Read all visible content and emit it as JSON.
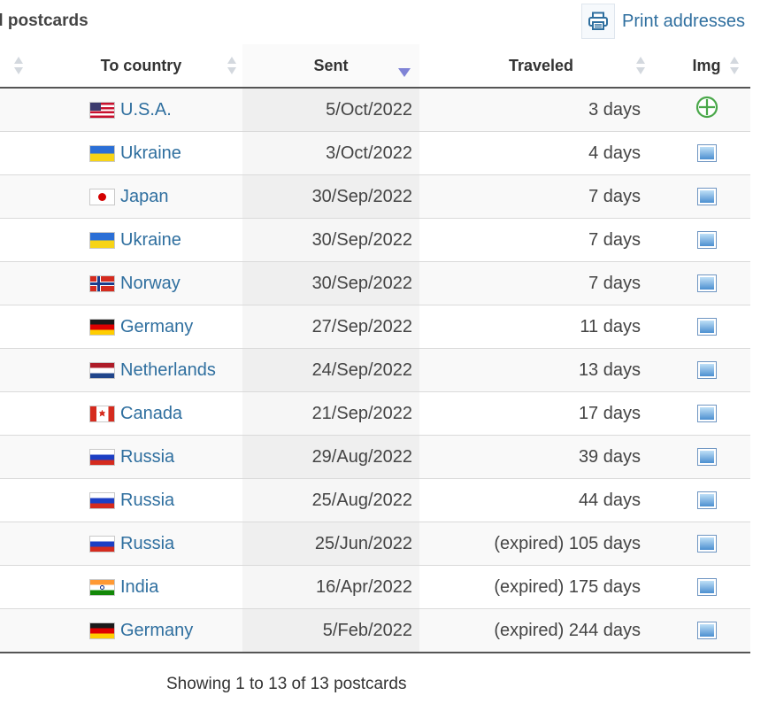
{
  "page": {
    "title": "d postcards"
  },
  "toolbar": {
    "print_label": "Print addresses"
  },
  "table": {
    "headers": {
      "to_country": "To country",
      "sent": "Sent",
      "traveled": "Traveled",
      "img": "Img"
    },
    "rows": [
      {
        "country": "U.S.A.",
        "flag": "us",
        "sent": "5/Oct/2022",
        "traveled": "3 days",
        "img": "add-icon"
      },
      {
        "country": "Ukraine",
        "flag": "ua",
        "sent": "3/Oct/2022",
        "traveled": "4 days",
        "img": "image-icon"
      },
      {
        "country": "Japan",
        "flag": "jp",
        "sent": "30/Sep/2022",
        "traveled": "7 days",
        "img": "image-icon"
      },
      {
        "country": "Ukraine",
        "flag": "ua",
        "sent": "30/Sep/2022",
        "traveled": "7 days",
        "img": "image-icon"
      },
      {
        "country": "Norway",
        "flag": "no",
        "sent": "30/Sep/2022",
        "traveled": "7 days",
        "img": "image-icon"
      },
      {
        "country": "Germany",
        "flag": "de",
        "sent": "27/Sep/2022",
        "traveled": "11 days",
        "img": "image-icon"
      },
      {
        "country": "Netherlands",
        "flag": "nl",
        "sent": "24/Sep/2022",
        "traveled": "13 days",
        "img": "image-icon"
      },
      {
        "country": "Canada",
        "flag": "ca",
        "sent": "21/Sep/2022",
        "traveled": "17 days",
        "img": "image-icon"
      },
      {
        "country": "Russia",
        "flag": "ru",
        "sent": "29/Aug/2022",
        "traveled": "39 days",
        "img": "image-icon"
      },
      {
        "country": "Russia",
        "flag": "ru",
        "sent": "25/Aug/2022",
        "traveled": "44 days",
        "img": "image-icon"
      },
      {
        "country": "Russia",
        "flag": "ru",
        "sent": "25/Jun/2022",
        "traveled": "(expired) 105 days",
        "img": "image-icon"
      },
      {
        "country": "India",
        "flag": "in",
        "sent": "16/Apr/2022",
        "traveled": "(expired) 175 days",
        "img": "image-icon"
      },
      {
        "country": "Germany",
        "flag": "de",
        "sent": "5/Feb/2022",
        "traveled": "(expired) 244 days",
        "img": "image-icon"
      }
    ]
  },
  "footer": {
    "summary": "Showing 1 to 13 of 13 postcards"
  },
  "colors": {
    "link": "#2f6f9f",
    "sort_active": "#7f83d6",
    "add_icon": "#4aa84a"
  }
}
